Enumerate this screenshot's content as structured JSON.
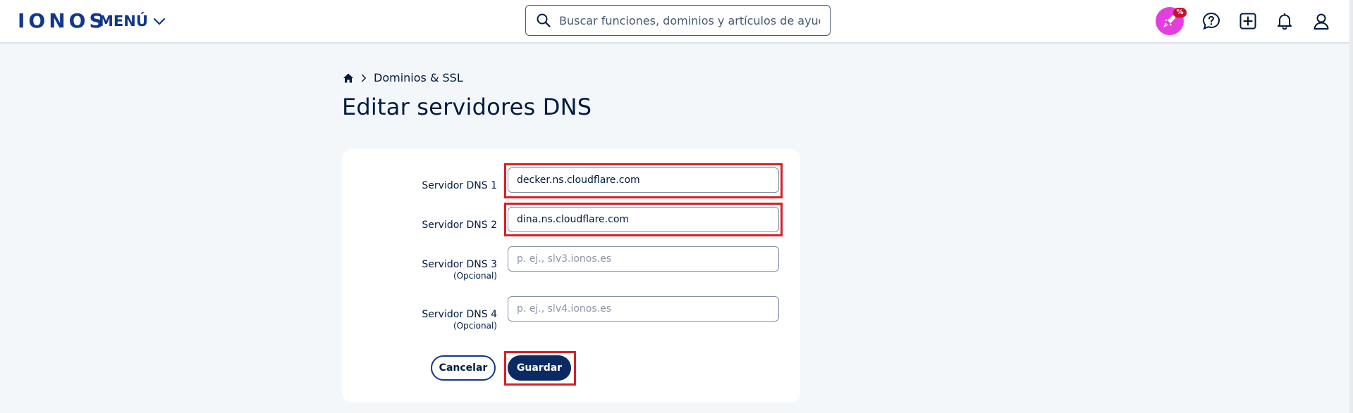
{
  "header": {
    "logo": "IONOS",
    "menu_label": "MENÚ",
    "search": {
      "placeholder": "Buscar funciones, dominios y artículos de ayuda",
      "value": ""
    },
    "promo_badge": "%",
    "icons": [
      "promo-rocket-icon",
      "help-icon",
      "add-icon",
      "bell-icon",
      "user-icon"
    ]
  },
  "breadcrumb": {
    "home_icon": "home-icon",
    "items": [
      "Dominios & SSL"
    ]
  },
  "page": {
    "title": "Editar servidores DNS"
  },
  "form": {
    "fields": [
      {
        "label": "Servidor DNS 1",
        "sublabel": "",
        "value": "decker.ns.cloudflare.com",
        "placeholder": "",
        "highlighted": true
      },
      {
        "label": "Servidor DNS 2",
        "sublabel": "",
        "value": "dina.ns.cloudflare.com",
        "placeholder": "",
        "highlighted": true
      },
      {
        "label": "Servidor DNS 3",
        "sublabel": "(Opcional)",
        "value": "",
        "placeholder": "p. ej., slv3.ionos.es",
        "highlighted": false
      },
      {
        "label": "Servidor DNS 4",
        "sublabel": "(Opcional)",
        "value": "",
        "placeholder": "p. ej., slv4.ionos.es",
        "highlighted": false
      }
    ],
    "cancel_label": "Cancelar",
    "save_label": "Guardar",
    "save_highlighted": true
  },
  "colors": {
    "brand": "#11388c",
    "primary_button": "#0b2a63",
    "highlight": "#d81f26",
    "promo": "#e33fe0",
    "page_bg": "#f4f7fa"
  }
}
